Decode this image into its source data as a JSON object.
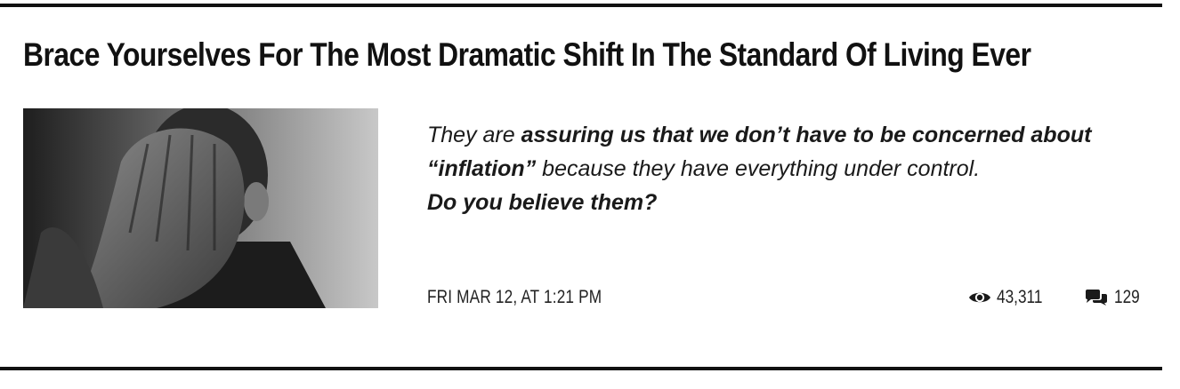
{
  "article": {
    "title": "Brace Yourselves For The Most Dramatic Shift In The Standard Of Living Ever",
    "excerpt": {
      "part1": "They are ",
      "part2_bold": "assuring us that we don’t have to be concerned about “inflation”",
      "part3": " because they have everything under control. ",
      "part4_bold": "Do you believe them?"
    },
    "date": "FRI MAR 12, AT 1:21 PM",
    "views": "43,311",
    "comments": "129",
    "thumbnail": {
      "subject": "grayscale photo of a man covering his face with both hands"
    }
  },
  "icons": {
    "views": "eye-icon",
    "comments": "comments-icon"
  },
  "colors": {
    "text": "#1a1a1a",
    "rule": "#111111",
    "background": "#ffffff"
  }
}
